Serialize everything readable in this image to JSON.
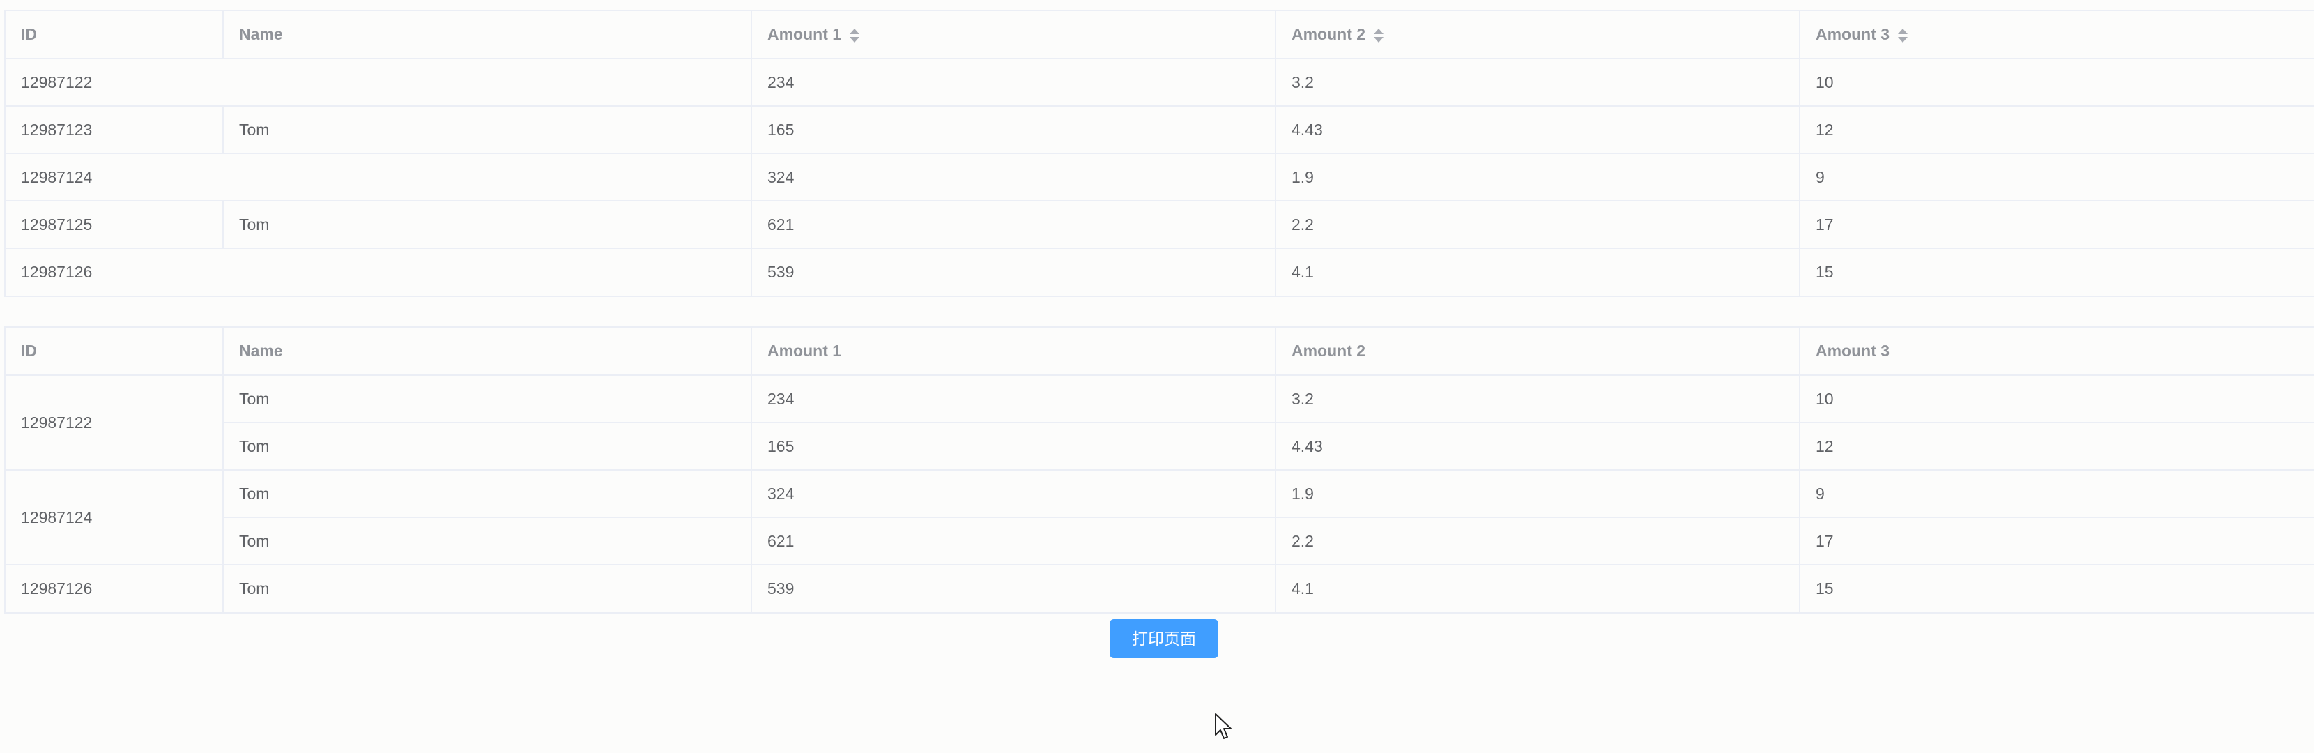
{
  "table1": {
    "headers": {
      "id": "ID",
      "name": "Name",
      "amount1": "Amount 1",
      "amount2": "Amount 2",
      "amount3": "Amount 3"
    },
    "sortable_columns": [
      "amount1",
      "amount2",
      "amount3"
    ],
    "rows": [
      {
        "id": "12987122",
        "name": "",
        "amount1": "234",
        "amount2": "3.2",
        "amount3": "10"
      },
      {
        "id": "12987123",
        "name": "Tom",
        "amount1": "165",
        "amount2": "4.43",
        "amount3": "12"
      },
      {
        "id": "12987124",
        "name": "",
        "amount1": "324",
        "amount2": "1.9",
        "amount3": "9"
      },
      {
        "id": "12987125",
        "name": "Tom",
        "amount1": "621",
        "amount2": "2.2",
        "amount3": "17"
      },
      {
        "id": "12987126",
        "name": "",
        "amount1": "539",
        "amount2": "4.1",
        "amount3": "15"
      }
    ]
  },
  "table2": {
    "headers": {
      "id": "ID",
      "name": "Name",
      "amount1": "Amount 1",
      "amount2": "Amount 2",
      "amount3": "Amount 3"
    },
    "groups": [
      {
        "id": "12987122",
        "rows": [
          {
            "name": "Tom",
            "amount1": "234",
            "amount2": "3.2",
            "amount3": "10"
          },
          {
            "name": "Tom",
            "amount1": "165",
            "amount2": "4.43",
            "amount3": "12"
          }
        ]
      },
      {
        "id": "12987124",
        "rows": [
          {
            "name": "Tom",
            "amount1": "324",
            "amount2": "1.9",
            "amount3": "9"
          },
          {
            "name": "Tom",
            "amount1": "621",
            "amount2": "2.2",
            "amount3": "17"
          }
        ]
      },
      {
        "id": "12987126",
        "rows": [
          {
            "name": "Tom",
            "amount1": "539",
            "amount2": "4.1",
            "amount3": "15"
          }
        ]
      }
    ]
  },
  "print_button": {
    "label": "打印页面",
    "color": "#409eff"
  },
  "colors": {
    "border": "#ebeef5",
    "header_text": "#909399",
    "cell_text": "#606266",
    "background": "#fcfcfb"
  }
}
